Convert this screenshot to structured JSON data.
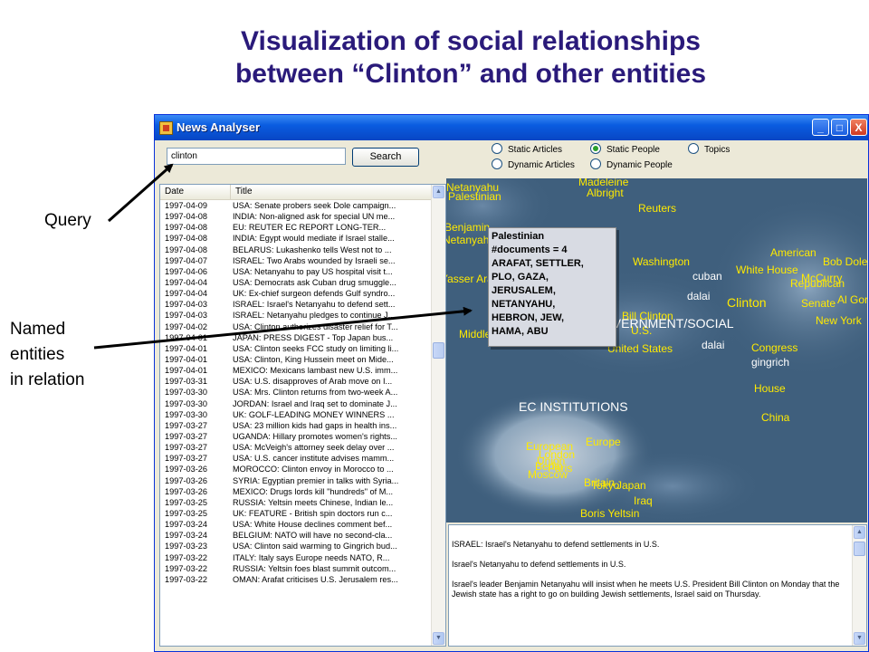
{
  "slide": {
    "title_line1": "Visualization of social relationships",
    "title_line2": "between “Clinton” and other entities"
  },
  "annotations": {
    "query": "Query",
    "named_line1": "Named",
    "named_line2": "entities",
    "named_line3": "in relation"
  },
  "window": {
    "title": "News Analyser",
    "minimize": "_",
    "maximize": "□",
    "close": "X"
  },
  "search": {
    "value": "clinton",
    "button_label": "Search"
  },
  "view_options": [
    {
      "label": "Static Articles",
      "selected": false
    },
    {
      "label": "Static People",
      "selected": true
    },
    {
      "label": "Topics",
      "selected": false
    },
    {
      "label": "Dynamic Articles",
      "selected": false
    },
    {
      "label": "Dynamic People",
      "selected": false
    }
  ],
  "list": {
    "columns": [
      "Date",
      "Title"
    ],
    "rows": [
      {
        "date": "1997-04-09",
        "title": "USA: Senate probers seek Dole campaign..."
      },
      {
        "date": "1997-04-08",
        "title": "INDIA: Non-aligned ask for special UN me..."
      },
      {
        "date": "1997-04-08",
        "title": "EU:  REUTER EC REPORT LONG-TER..."
      },
      {
        "date": "1997-04-08",
        "title": "INDIA: Egypt would mediate if Israel stalle..."
      },
      {
        "date": "1997-04-08",
        "title": "BELARUS: Lukashenko tells West not to ..."
      },
      {
        "date": "1997-04-07",
        "title": "ISRAEL: Two Arabs wounded by Israeli se..."
      },
      {
        "date": "1997-04-06",
        "title": "USA: Netanyahu to pay US hospital visit t..."
      },
      {
        "date": "1997-04-04",
        "title": "USA: Democrats ask Cuban drug smuggle..."
      },
      {
        "date": "1997-04-04",
        "title": "UK: Ex-chief surgeon defends Gulf syndro..."
      },
      {
        "date": "1997-04-03",
        "title": "ISRAEL: Israel's Netanyahu to defend sett..."
      },
      {
        "date": "1997-04-03",
        "title": "ISRAEL: Netanyahu pledges to continue J..."
      },
      {
        "date": "1997-04-02",
        "title": "USA: Clinton authorizes disaster relief for T..."
      },
      {
        "date": "1997-04-01",
        "title": "JAPAN: PRESS DIGEST - Top Japan bus..."
      },
      {
        "date": "1997-04-01",
        "title": "USA: Clinton seeks FCC study on limiting li..."
      },
      {
        "date": "1997-04-01",
        "title": "USA: Clinton, King Hussein meet on Mide..."
      },
      {
        "date": "1997-04-01",
        "title": "MEXICO: Mexicans lambast new U.S. imm..."
      },
      {
        "date": "1997-03-31",
        "title": "USA: U.S. disapproves of Arab move on I..."
      },
      {
        "date": "1997-03-30",
        "title": "USA: Mrs. Clinton returns from two-week A..."
      },
      {
        "date": "1997-03-30",
        "title": "JORDAN: Israel and Iraq set to dominate J..."
      },
      {
        "date": "1997-03-30",
        "title": "UK: GOLF-LEADING MONEY WINNERS ..."
      },
      {
        "date": "1997-03-27",
        "title": "USA: 23 million kids had gaps in health ins..."
      },
      {
        "date": "1997-03-27",
        "title": "UGANDA: Hillary promotes women's rights..."
      },
      {
        "date": "1997-03-27",
        "title": "USA: McVeigh's attorney seek delay over ..."
      },
      {
        "date": "1997-03-27",
        "title": "USA: U.S. cancer institute advises mamm..."
      },
      {
        "date": "1997-03-26",
        "title": "MOROCCO: Clinton envoy in Morocco to ..."
      },
      {
        "date": "1997-03-26",
        "title": "SYRIA: Egyptian premier in talks with Syria..."
      },
      {
        "date": "1997-03-26",
        "title": "MEXICO: Drugs lords kill \"hundreds\" of M..."
      },
      {
        "date": "1997-03-25",
        "title": "RUSSIA: Yeltsin meets Chinese, Indian le..."
      },
      {
        "date": "1997-03-25",
        "title": "UK: FEATURE - British spin doctors run c..."
      },
      {
        "date": "1997-03-24",
        "title": "USA: White House declines comment bef..."
      },
      {
        "date": "1997-03-24",
        "title": "BELGIUM: NATO will have no second-cla..."
      },
      {
        "date": "1997-03-23",
        "title": "USA: Clinton said warming to Gingrich bud..."
      },
      {
        "date": "1997-03-22",
        "title": "ITALY: Italy says Europe needs NATO, R..."
      },
      {
        "date": "1997-03-22",
        "title": "RUSSIA: Yeltsin foes blast summit outcom..."
      },
      {
        "date": "1997-03-22",
        "title": "OMAN: Arafat criticises U.S. Jerusalem res..."
      }
    ]
  },
  "visualization": {
    "region_labels": [
      "GOVERNMENT/SOCIAL",
      "EC INSTITUTIONS"
    ],
    "entities": [
      "Netanyahu",
      "Palestinian",
      "Madeleine",
      "Albright",
      "Reuters",
      "Benjamin",
      "Netanyahu",
      "Washington",
      "cuban",
      "dalai",
      "American",
      "White House",
      "Bob Dole",
      "McCurry",
      "Republican",
      "Al Gore",
      "Senate",
      "New York",
      "Clinton",
      "Bill Clinton",
      "U.S.",
      "United States",
      "dalai",
      "Congress",
      "gingrich",
      "House",
      "China",
      "Yasser Arafat",
      "Middle",
      "European",
      "Union",
      "Europe",
      "Moscow",
      "Britain",
      "Japan",
      "Iraq",
      "Boris Yeltsin",
      "London",
      "Paris",
      "Berlin",
      "Tokyo"
    ],
    "tooltip_lines": [
      "Palestinian",
      "#documents = 4",
      "ARAFAT, SETTLER,",
      "PLO, GAZA,",
      "JERUSALEM,",
      "NETANYAHU,",
      "HEBRON, JEW,",
      "HAMA, ABU"
    ]
  },
  "article": {
    "headline": "ISRAEL: Israel's Netanyahu to defend settlements in U.S.",
    "subhead": "Israel's Netanyahu to defend settlements in U.S.",
    "body": "Israel's leader Benjamin Netanyahu will insist when he meets U.S. President Bill Clinton on Monday that the Jewish state has a right to go on building Jewish settlements, Israel said on Thursday."
  }
}
